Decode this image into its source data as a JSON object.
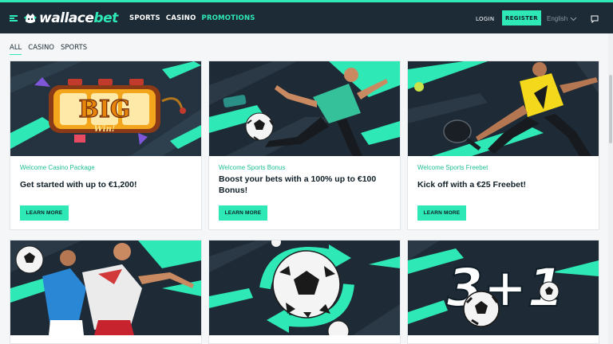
{
  "brand": {
    "name_white": "wallace",
    "name_green": "bet",
    "accent": "#2ee8b6",
    "dark": "#1c2b36"
  },
  "header": {
    "nav": [
      "SPORTS",
      "CASINO",
      "PROMOTIONS"
    ],
    "active_nav": "PROMOTIONS",
    "login": "LOGIN",
    "register": "REGISTER",
    "language": "English"
  },
  "filters": {
    "items": [
      "ALL",
      "CASINO",
      "SPORTS"
    ],
    "active": "ALL"
  },
  "promos": [
    {
      "tag": "Welcome Casino Package",
      "title": "Get started with up to €1,200!",
      "button": "LEARN MORE",
      "image_label": "BIG",
      "image_sub": "Win!"
    },
    {
      "tag": "Welcome Sports Bonus",
      "title": "Boost your bets with a 100% up to €100 Bonus!",
      "button": "LEARN MORE"
    },
    {
      "tag": "Welcome Sports Freebet",
      "title": "Kick off with a €25 Freebet!",
      "button": "LEARN MORE"
    },
    {
      "tag": "",
      "title": "",
      "button": ""
    },
    {
      "tag": "",
      "title": "",
      "button": ""
    },
    {
      "tag": "",
      "title": "",
      "button": "",
      "image_label": "3+1"
    }
  ]
}
